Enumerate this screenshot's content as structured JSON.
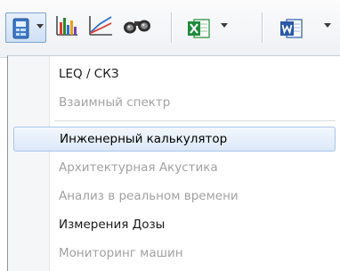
{
  "toolbar": {
    "buttons": [
      {
        "name": "document-app-icon",
        "pressed": true,
        "has_dropdown": true
      },
      {
        "name": "bar-chart-icon",
        "pressed": false,
        "has_dropdown": false
      },
      {
        "name": "curve-chart-icon",
        "pressed": false,
        "has_dropdown": false
      },
      {
        "name": "binoculars-icon",
        "pressed": false,
        "has_dropdown": false
      },
      {
        "name": "excel-icon",
        "pressed": false,
        "has_dropdown": true
      },
      {
        "name": "word-icon",
        "pressed": false,
        "has_dropdown": true
      }
    ]
  },
  "menu": {
    "items": [
      {
        "label": "LEQ / СКЗ",
        "state": "enabled"
      },
      {
        "label": "Взаимный спектр",
        "state": "disabled"
      },
      {
        "label": "Инженерный калькулятор",
        "state": "highlighted"
      },
      {
        "label": "Архитектурная  Акустика",
        "state": "disabled"
      },
      {
        "label": "Анализ в реальном времени",
        "state": "disabled"
      },
      {
        "label": "Измерения Дозы",
        "state": "enabled"
      },
      {
        "label": "Мониторинг машин",
        "state": "disabled"
      }
    ]
  },
  "colors": {
    "excel_green": "#1f8a3b",
    "word_blue": "#2a5aa8",
    "highlight_border": "#a8c6ea",
    "disabled_text": "#a2a2a2"
  }
}
